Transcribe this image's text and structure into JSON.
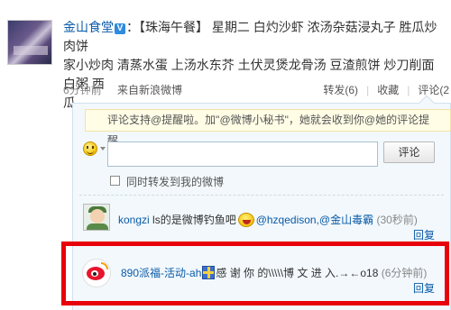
{
  "post": {
    "author": "金山食堂",
    "verified_badge": "V",
    "text_line1": "：【珠海午餐】 星期二 白灼沙虾 浓汤杂菇浸丸子 胜瓜炒肉饼",
    "text_line2": "家小炒肉 清蒸水蛋 上汤水东芥 土伏灵煲龙骨汤 豆渣煎饼 炒刀削面 白粥 西",
    "text_line3": "瓜"
  },
  "meta": {
    "time": "6分钟前",
    "source": "来自新浪微博",
    "repost": "转发(6)",
    "favorite": "收藏",
    "comment": "评论(2"
  },
  "comment_box": {
    "tip": "评论支持@提醒啦。加\"@微博小秘书\"，她就会收到你@她的评论提醒。",
    "input_value": "",
    "submit_label": "评论",
    "repost_checkbox_label": "同时转发到我的微博"
  },
  "comments": [
    {
      "name": "kongzi",
      "text": " ls的是微博钓鱼吧",
      "mention": "@hzqedison,@金山毒霸",
      "time": "(30秒前)",
      "reply": "回复",
      "emoji": "laugh-emoji"
    },
    {
      "name": "890派福-活动-ah",
      "text": "感 谢 你 的\\\\\\\\\\博 文 进 入.→←o18",
      "time": "(6分钟前)",
      "reply": "回复",
      "emoji": "gift-emoji"
    }
  ],
  "colors": {
    "link_blue": "#0a5aa8",
    "highlight_red": "#e8000a",
    "tip_bg": "#fffde6",
    "comment_bg": "#f2f8fc"
  }
}
